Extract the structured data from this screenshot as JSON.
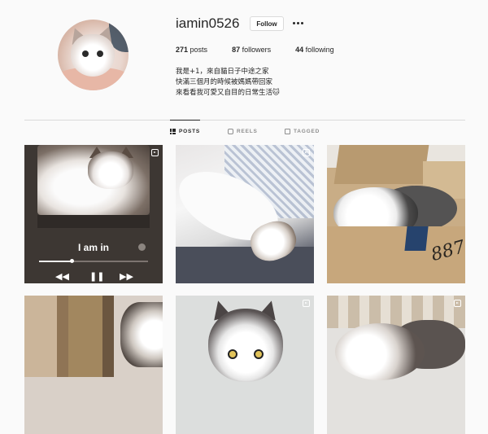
{
  "profile": {
    "username": "iamin0526",
    "follow_label": "Follow",
    "stats": {
      "posts_count": "271",
      "posts_label": "posts",
      "followers_count": "87",
      "followers_label": "followers",
      "following_count": "44",
      "following_label": "following"
    },
    "bio": [
      "我是+1，來自貓日子中途之家",
      "快滿三個月的時候被媽媽帶回家",
      "來看看我可愛又自目的日常生活🐱"
    ]
  },
  "tabs": [
    {
      "label": "POSTS",
      "icon": "grid-icon",
      "active": true
    },
    {
      "label": "REELS",
      "icon": "reels-icon",
      "active": false
    },
    {
      "label": "TAGGED",
      "icon": "tagged-icon",
      "active": false
    }
  ],
  "posts": [
    {
      "type": "reel",
      "song_title": "I am in"
    },
    {
      "type": "reel"
    },
    {
      "type": "photo",
      "box_number": "887"
    },
    {
      "type": "photo"
    },
    {
      "type": "reel"
    },
    {
      "type": "reel"
    }
  ],
  "colors": {
    "background": "#fafafa",
    "text": "#262626",
    "muted": "#8e8e8e",
    "border": "#dbdbdb"
  }
}
